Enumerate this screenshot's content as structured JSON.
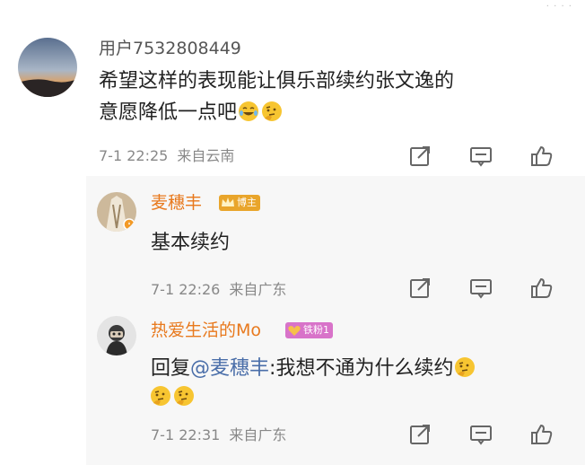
{
  "comments": [
    {
      "username": "用户7532808449",
      "text": "希望这样的表现能让俱乐部续约张文逸的",
      "text_line2": "意愿降低一点吧",
      "time": "7-1 22:25",
      "location": "来自云南"
    }
  ],
  "replies": [
    {
      "username": "麦穗丰",
      "badge": "博主",
      "text": "基本续约",
      "time": "7-1 22:26",
      "location": "来自广东"
    },
    {
      "username": "热爱生活的Mo",
      "badge": "铁粉1",
      "reply_prefix": "回复",
      "mention": "@麦穗丰",
      "text": ":我想不通为什么续约",
      "time": "7-1 22:31",
      "location": "来自广东"
    }
  ],
  "icons": [
    "share-icon",
    "comment-icon",
    "like-icon",
    "laugh-cry-emoji",
    "thinking-emoji"
  ],
  "colors": {
    "username_highlight": "#e8791d",
    "mention": "#4a6ea9",
    "meta": "#888888",
    "reply_bg": "#f7f7f7"
  }
}
